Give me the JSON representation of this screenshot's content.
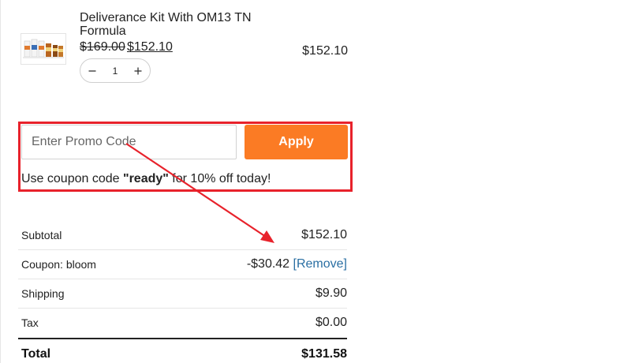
{
  "product": {
    "name": "Deliverance Kit With OM13 TN Formula",
    "original_price": "$169.00",
    "sale_price": "$152.10",
    "line_total": "$152.10",
    "quantity": "1",
    "decrement_icon": "minus-icon",
    "increment_icon": "plus-icon"
  },
  "promo": {
    "placeholder": "Enter Promo Code",
    "apply_label": "Apply",
    "note_prefix": "Use coupon code ",
    "note_code": "\"ready\"",
    "note_suffix": " for 10% off today!",
    "highlight_color": "#e8222b",
    "button_color": "#fb7b24"
  },
  "summary": {
    "subtotal_label": "Subtotal",
    "subtotal_value": "$152.10",
    "coupon_label": "Coupon: bloom",
    "coupon_value": "-$30.42",
    "coupon_remove": "[Remove]",
    "shipping_label": "Shipping",
    "shipping_value": "$9.90",
    "tax_label": "Tax",
    "tax_value": "$0.00",
    "total_label": "Total",
    "total_value": "$131.58"
  }
}
